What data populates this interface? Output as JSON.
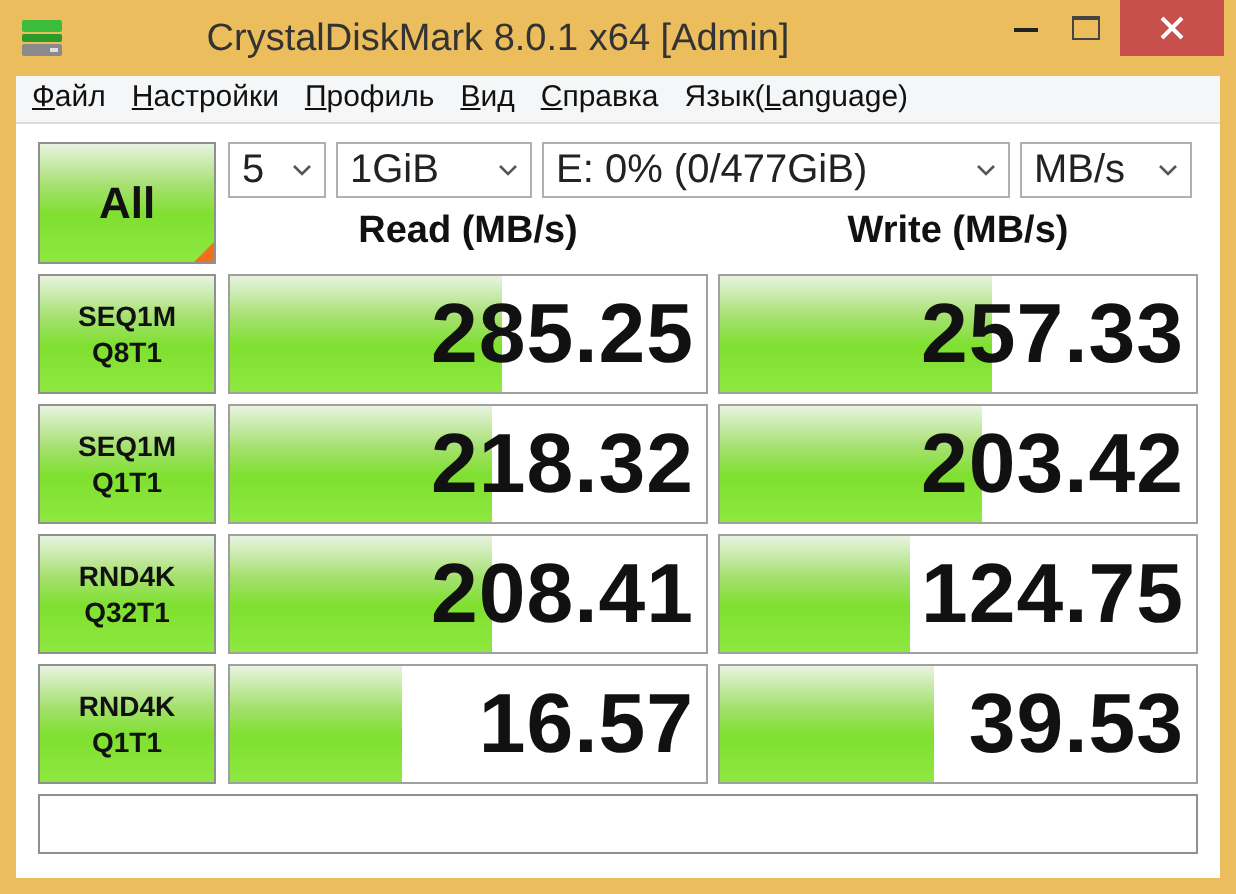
{
  "window": {
    "title": "CrystalDiskMark 8.0.1 x64 [Admin]"
  },
  "menu": [
    {
      "key": "Ф",
      "after": "айл"
    },
    {
      "key": "Н",
      "after": "астройки"
    },
    {
      "key": "П",
      "after": "рофиль"
    },
    {
      "key": "В",
      "after": "ид"
    },
    {
      "key": "С",
      "after": "правка"
    },
    {
      "before": "Язык(",
      "key": "L",
      "after": "anguage)"
    }
  ],
  "all_button": {
    "label": "All"
  },
  "selects": [
    {
      "value": "5"
    },
    {
      "value": "1GiB"
    },
    {
      "value": "E: 0% (0/477GiB)"
    },
    {
      "value": "MB/s"
    }
  ],
  "columns": [
    "Read (MB/s)",
    "Write (MB/s)"
  ],
  "rows": [
    {
      "test": [
        "SEQ1M",
        "Q8T1"
      ],
      "read": {
        "value": "285.25",
        "level": 0.57
      },
      "write": {
        "value": "257.33",
        "level": 0.57
      }
    },
    {
      "test": [
        "SEQ1M",
        "Q1T1"
      ],
      "read": {
        "value": "218.32",
        "level": 0.55
      },
      "write": {
        "value": "203.42",
        "level": 0.55
      }
    },
    {
      "test": [
        "RND4K",
        "Q32T1"
      ],
      "read": {
        "value": "208.41",
        "level": 0.55
      },
      "write": {
        "value": "124.75",
        "level": 0.4
      }
    },
    {
      "test": [
        "RND4K",
        "Q1T1"
      ],
      "read": {
        "value": "16.57",
        "level": 0.36
      },
      "write": {
        "value": "39.53",
        "level": 0.45
      }
    }
  ]
}
